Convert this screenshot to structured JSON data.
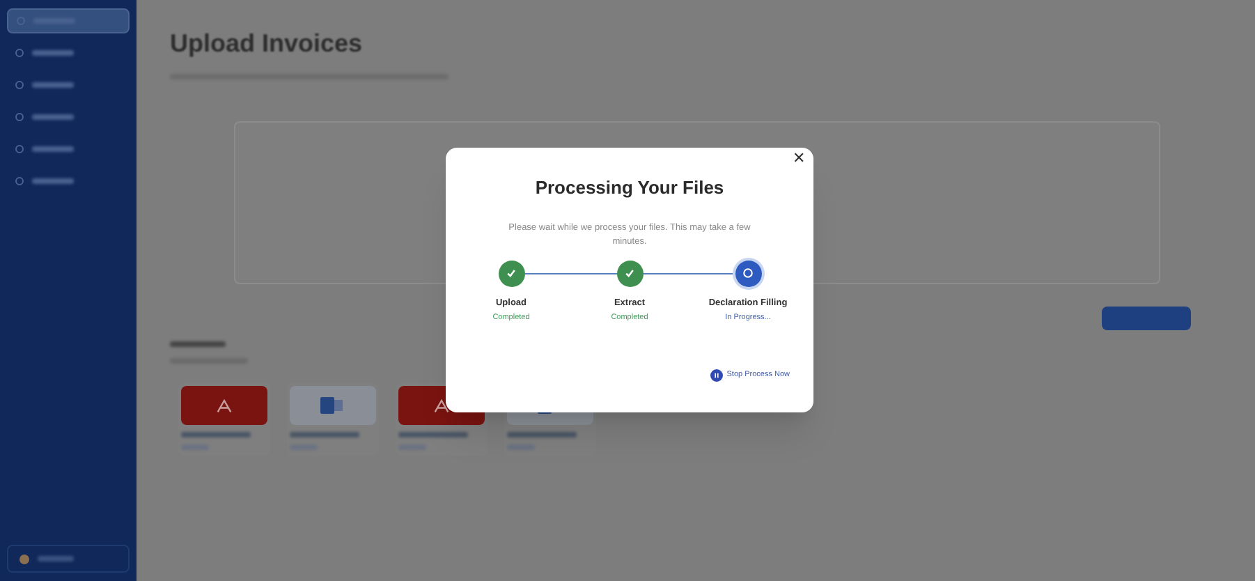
{
  "page": {
    "title": "Upload Invoices"
  },
  "sidebar": {
    "items": [
      {
        "selected": true
      },
      {
        "selected": false
      },
      {
        "selected": false
      },
      {
        "selected": false
      },
      {
        "selected": false
      },
      {
        "selected": false
      }
    ]
  },
  "files": [
    {
      "kind": "pdf"
    },
    {
      "kind": "doc"
    },
    {
      "kind": "pdf"
    },
    {
      "kind": "doc"
    }
  ],
  "dialog": {
    "title": "Processing Your Files",
    "close": "✕",
    "message": "Please wait while we process your files. This may take a few minutes.",
    "steps": [
      {
        "label": "Upload",
        "status": "Completed",
        "kind": "done"
      },
      {
        "label": "Extract",
        "status": "Completed",
        "kind": "done"
      },
      {
        "label": "Declaration Filling",
        "status": "In Progress...",
        "kind": "active"
      }
    ],
    "stop_button": "Stop Process Now"
  }
}
